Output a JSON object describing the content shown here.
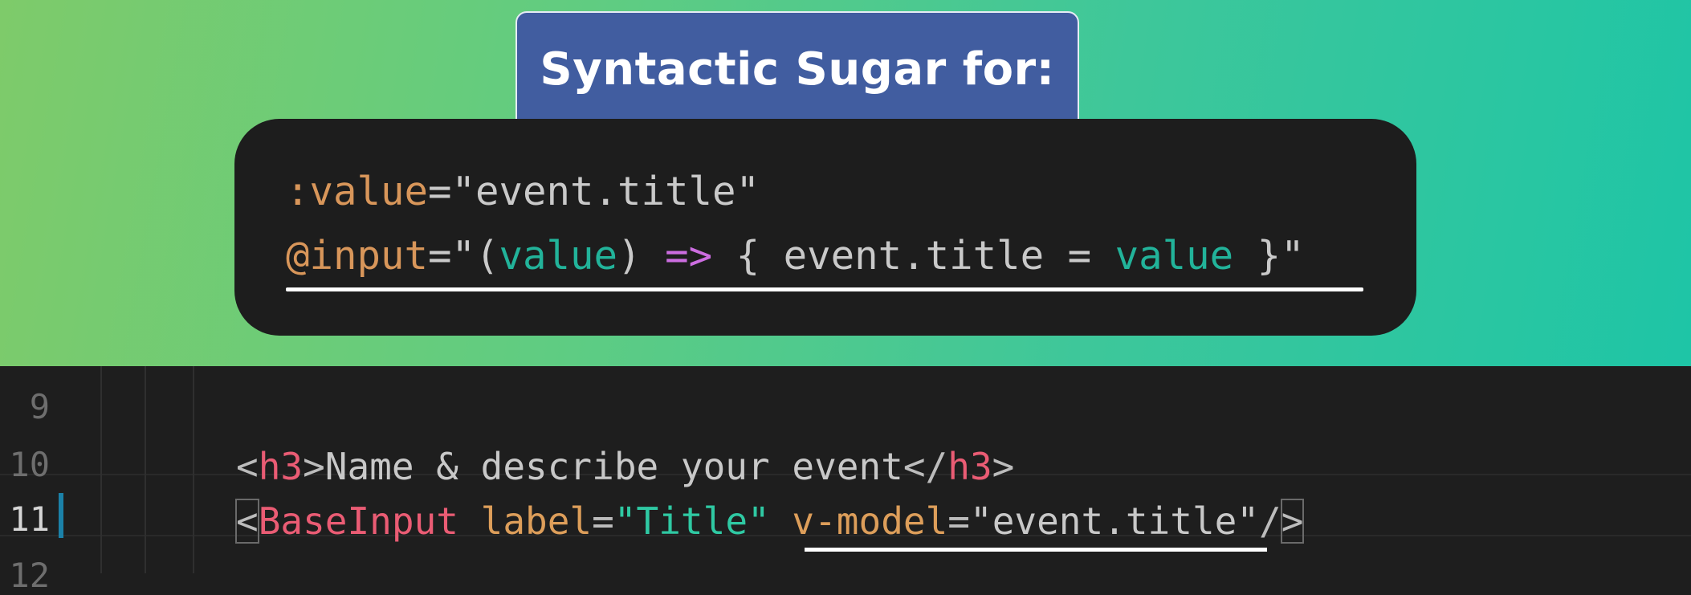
{
  "header": {
    "title": "Syntactic Sugar for:"
  },
  "snippet": {
    "line1": {
      "attr": ":value",
      "eq": "=",
      "value": "\"event.title\""
    },
    "line2": {
      "attr": "@input",
      "eq": "=\"(",
      "param": "value",
      "close_paren": ") ",
      "arrow": "=>",
      "body_start": " { event.title = ",
      "body_value": "value",
      "body_end": " }\""
    }
  },
  "editor": {
    "line_numbers": [
      "9",
      "10",
      "11",
      "12"
    ],
    "active_line": "11",
    "line10": {
      "open_lt": "<",
      "open_tag": "h3",
      "open_gt": ">",
      "text": "Name & describe your event",
      "close_lt": "</",
      "close_tag": "h3",
      "close_gt": ">"
    },
    "line11": {
      "lt": "<",
      "component": "BaseInput",
      "attr1": "label",
      "eq1": "=",
      "val1": "\"Title\"",
      "attr2": "v-model",
      "eq2": "=",
      "val2": "\"event.title\"",
      "slash": "/",
      "gt": ">"
    }
  }
}
